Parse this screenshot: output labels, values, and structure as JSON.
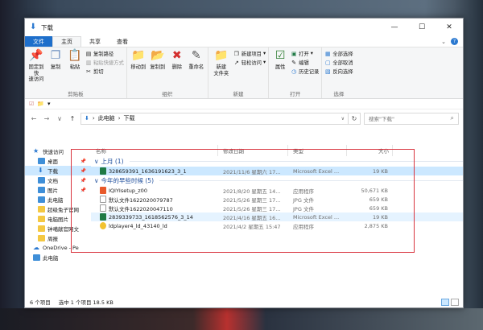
{
  "window": {
    "title": "下载"
  },
  "ribbon_tabs": [
    "文件",
    "主页",
    "共享",
    "查看"
  ],
  "ribbon": {
    "clipboard": {
      "label": "剪贴板",
      "pin": "固定到快\n速访问",
      "copy": "复制",
      "paste": "粘贴",
      "copy_path": "复制路径",
      "paste_shortcut": "粘贴快捷方式",
      "cut": "剪切"
    },
    "organize": {
      "label": "组织",
      "move_to": "移动到",
      "copy_to": "复制到",
      "delete": "删除",
      "rename": "重命名"
    },
    "new": {
      "label": "新建",
      "new_folder": "新建\n文件夹",
      "new_item": "新建项目",
      "easy_access": "轻松访问"
    },
    "open": {
      "label": "打开",
      "properties": "属性",
      "open": "打开",
      "edit": "编辑",
      "history": "历史记录"
    },
    "select": {
      "label": "选择",
      "select_all": "全部选择",
      "select_none": "全部取消",
      "invert": "反向选择"
    }
  },
  "address": {
    "path": [
      "此电脑",
      "下载"
    ],
    "search_placeholder": "搜索\"下载\""
  },
  "nav_pane": [
    {
      "label": "快速访问",
      "icon": "star-icon",
      "top": true
    },
    {
      "label": "桌面",
      "icon": "desktop-icon",
      "pinned": true
    },
    {
      "label": "下载",
      "icon": "download-icon",
      "pinned": true,
      "selected": true
    },
    {
      "label": "文档",
      "icon": "document-icon",
      "pinned": true
    },
    {
      "label": "图片",
      "icon": "pictures-icon",
      "pinned": true
    },
    {
      "label": "此电脑",
      "icon": "computer-icon"
    },
    {
      "label": "超级兔子官网",
      "icon": "folder-icon"
    },
    {
      "label": "电脑图片",
      "icon": "folder-icon"
    },
    {
      "label": "钟噶献官网文",
      "icon": "folder-icon"
    },
    {
      "label": "周报",
      "icon": "folder-icon"
    },
    {
      "label": "OneDrive - Pe",
      "icon": "cloud-icon",
      "top": true
    },
    {
      "label": "此电脑",
      "icon": "computer-icon",
      "top": true
    }
  ],
  "columns": [
    "名称",
    "修改日期",
    "类型",
    "大小"
  ],
  "groups": [
    {
      "title": "上月 (1)",
      "rows": [
        {
          "name": "328659391_1636191623_3_1",
          "date": "2021/11/6 星期六 17...",
          "type": "Microsoft Excel ...",
          "size": "19 KB",
          "icon": "xls",
          "state": "sel"
        }
      ]
    },
    {
      "title": "今年的早些时候 (5)",
      "rows": [
        {
          "name": "IQIYIsetup_z00",
          "date": "2021/8/20 星期五 14...",
          "type": "应用程序",
          "size": "50,671 KB",
          "icon": "exe",
          "state": ""
        },
        {
          "name": "默认文件1622020079787",
          "date": "2021/5/26 星期三 17...",
          "type": "JPG 文件",
          "size": "659 KB",
          "icon": "jpg",
          "state": ""
        },
        {
          "name": "默认文件1622020047110",
          "date": "2021/5/26 星期三 17...",
          "type": "JPG 文件",
          "size": "659 KB",
          "icon": "jpg",
          "state": ""
        },
        {
          "name": "2839339733_1618562576_3_14",
          "date": "2021/4/16 星期五 16...",
          "type": "Microsoft Excel ...",
          "size": "19 KB",
          "icon": "xls",
          "state": "hl"
        },
        {
          "name": "ldplayer4_ld_43140_ld",
          "date": "2021/4/2 星期五 15:47",
          "type": "应用程序",
          "size": "2,875 KB",
          "icon": "ld",
          "state": ""
        }
      ]
    }
  ],
  "status": {
    "count": "6 个项目",
    "selected": "选中 1 个项目  18.5 KB"
  },
  "colors": {
    "accent": "#1e6fcb",
    "selection": "#cce8ff",
    "highlight_box": "#d9343e"
  }
}
